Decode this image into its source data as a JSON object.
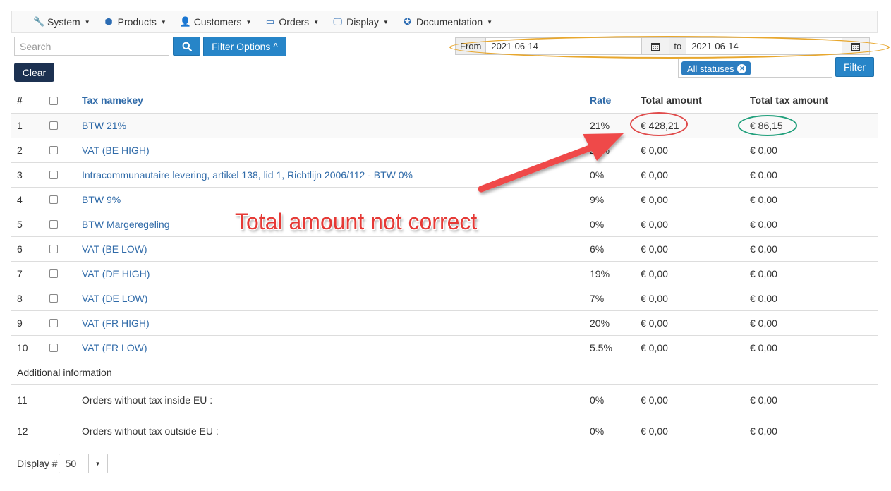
{
  "menu": [
    {
      "label": "System",
      "icon": "wrench-icon",
      "glyph": "🔧"
    },
    {
      "label": "Products",
      "icon": "cubes-icon",
      "glyph": "⬢"
    },
    {
      "label": "Customers",
      "icon": "user-icon",
      "glyph": "👤"
    },
    {
      "label": "Orders",
      "icon": "credit-card-icon",
      "glyph": "▭"
    },
    {
      "label": "Display",
      "icon": "monitor-icon",
      "glyph": "🖵"
    },
    {
      "label": "Documentation",
      "icon": "life-ring-icon",
      "glyph": "✪"
    }
  ],
  "toolbar": {
    "search_placeholder": "Search",
    "filter_options_label": "Filter Options",
    "clear_label": "Clear",
    "filter_label": "Filter"
  },
  "date_range": {
    "from_label": "From",
    "from_value": "2021-06-14",
    "to_label": "to",
    "to_value": "2021-06-14"
  },
  "status_filter": {
    "chip": "All statuses"
  },
  "table": {
    "headers": {
      "num": "#",
      "name": "Tax namekey",
      "rate": "Rate",
      "total": "Total amount",
      "tax": "Total tax amount"
    },
    "rows": [
      {
        "num": "1",
        "name": "BTW 21%",
        "rate": "21%",
        "total": "€ 428,21",
        "tax": "€ 86,15"
      },
      {
        "num": "2",
        "name": "VAT (BE HIGH)",
        "rate": "21%",
        "total": "€ 0,00",
        "tax": "€ 0,00"
      },
      {
        "num": "3",
        "name": "Intracommunautaire levering, artikel 138, lid 1, Richtlijn 2006/112 - BTW 0%",
        "rate": "0%",
        "total": "€ 0,00",
        "tax": "€ 0,00"
      },
      {
        "num": "4",
        "name": "BTW 9%",
        "rate": "9%",
        "total": "€ 0,00",
        "tax": "€ 0,00"
      },
      {
        "num": "5",
        "name": "BTW Margeregeling",
        "rate": "0%",
        "total": "€ 0,00",
        "tax": "€ 0,00"
      },
      {
        "num": "6",
        "name": "VAT (BE LOW)",
        "rate": "6%",
        "total": "€ 0,00",
        "tax": "€ 0,00"
      },
      {
        "num": "7",
        "name": "VAT (DE HIGH)",
        "rate": "19%",
        "total": "€ 0,00",
        "tax": "€ 0,00"
      },
      {
        "num": "8",
        "name": "VAT (DE LOW)",
        "rate": "7%",
        "total": "€ 0,00",
        "tax": "€ 0,00"
      },
      {
        "num": "9",
        "name": "VAT (FR HIGH)",
        "rate": "20%",
        "total": "€ 0,00",
        "tax": "€ 0,00"
      },
      {
        "num": "10",
        "name": "VAT (FR LOW)",
        "rate": "5.5%",
        "total": "€ 0,00",
        "tax": "€ 0,00"
      }
    ],
    "additional_label": "Additional information",
    "extra_rows": [
      {
        "num": "11",
        "name": "Orders without tax inside EU :",
        "rate": "0%",
        "total": "€ 0,00",
        "tax": "€ 0,00"
      },
      {
        "num": "12",
        "name": "Orders without tax outside EU :",
        "rate": "0%",
        "total": "€ 0,00",
        "tax": "€ 0,00"
      }
    ]
  },
  "footer": {
    "display_label": "Display #",
    "display_value": "50"
  },
  "annotation": {
    "text": "Total amount not correct",
    "red": "#e53935",
    "green": "#22a07c",
    "orange": "#e8a72d"
  },
  "colors": {
    "primary": "#2785c8",
    "dark": "#1c3151",
    "link": "#2f6aa8"
  }
}
